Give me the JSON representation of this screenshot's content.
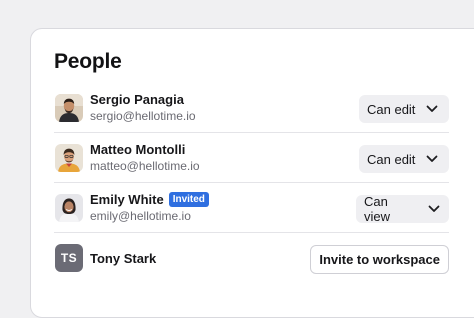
{
  "panel": {
    "title": "People"
  },
  "people": [
    {
      "name": "Sergio Panagia",
      "email": "sergio@hellotime.io",
      "role": "Can edit",
      "avatar": "photo-avatar"
    },
    {
      "name": "Matteo Montolli",
      "email": "matteo@hellotime.io",
      "role": "Can edit",
      "avatar": "photo-avatar"
    },
    {
      "name": "Emily White",
      "badge": "Invited",
      "email": "emily@hellotime.io",
      "role": "Can view",
      "avatar": "photo-avatar"
    },
    {
      "name": "Tony Stark",
      "initials": "TS",
      "action": "Invite to workspace"
    }
  ],
  "icons": {
    "dropdown": "chevron-down-icon"
  },
  "colors": {
    "badge": "#2f6fe0",
    "initials_avatar": "#6b6b75"
  }
}
